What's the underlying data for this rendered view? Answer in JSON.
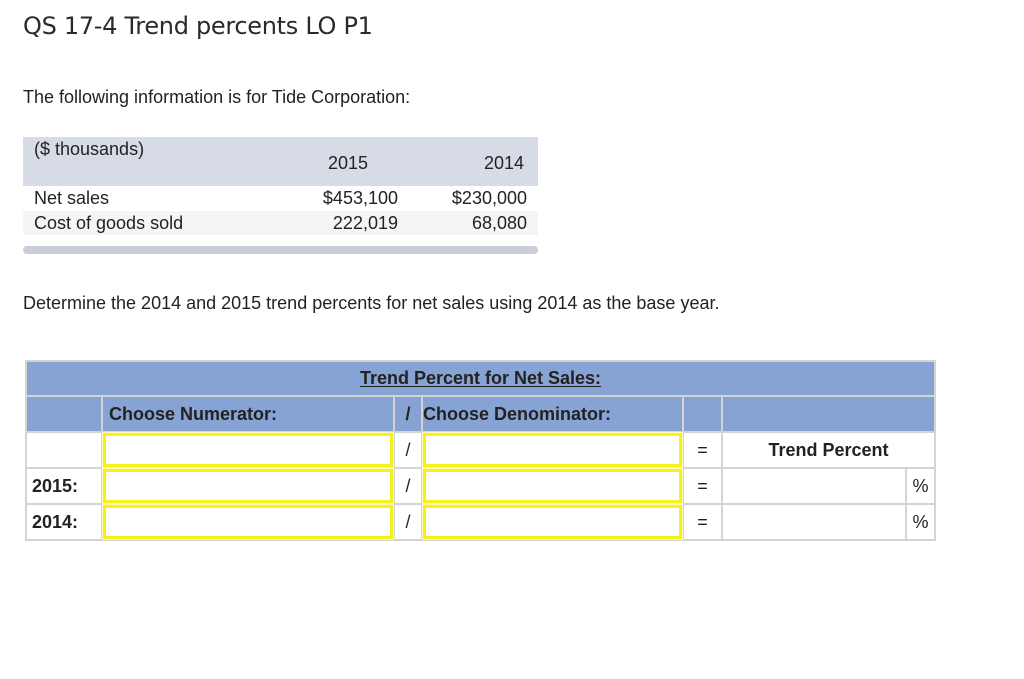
{
  "title": "QS 17-4 Trend percents LO P1",
  "intro": "The following information is for Tide Corporation:",
  "data_table": {
    "unit_label": "($ thousands)",
    "years": [
      "2015",
      "2014"
    ],
    "rows": [
      {
        "label": "Net sales",
        "values": [
          "$453,100",
          "$230,000"
        ]
      },
      {
        "label": "Cost of goods sold",
        "values": [
          "222,019",
          "68,080"
        ]
      }
    ]
  },
  "instruction": "Determine the 2014 and 2015 trend percents for net sales using 2014 as the base year.",
  "answer_table": {
    "caption": "Trend Percent for Net Sales:",
    "numerator_header": "Choose Numerator:",
    "slash_symbol": "/",
    "denominator_header": "Choose Denominator:",
    "equals_symbol": "=",
    "result_header": "Trend Percent",
    "percent_symbol": "%",
    "rows": [
      {
        "label": "",
        "numerator": "",
        "denominator": ""
      },
      {
        "label": "2015:",
        "numerator": "",
        "denominator": "",
        "result": ""
      },
      {
        "label": "2014:",
        "numerator": "",
        "denominator": "",
        "result": ""
      }
    ]
  },
  "colors": {
    "answer_header_bg": "#87a3d4",
    "data_header_bg": "#d7dbe5",
    "input_border": "#f5f21a"
  }
}
